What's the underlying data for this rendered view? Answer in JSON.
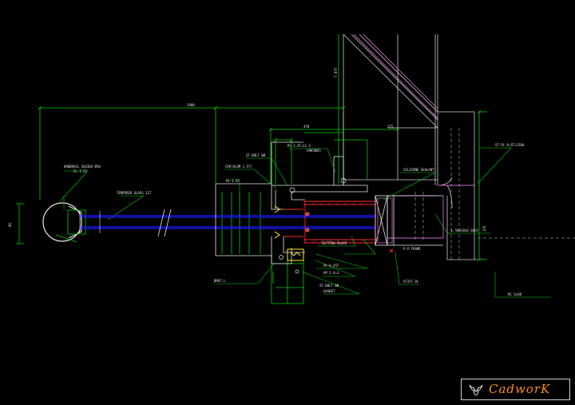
{
  "drawing": {
    "background": "#000000",
    "colors": {
      "outline": "#e0e0e0",
      "dimension": "#00d000",
      "glass": "#1a1aff",
      "section_red": "#ff2a2a",
      "mullion": "#cc66cc",
      "gasket": "#ffee33",
      "note_text": "#e8e8e8"
    },
    "dimensions": {
      "overall": "2400",
      "rail_height": "80",
      "vertical_top": "T 875",
      "depth_a": "470",
      "depth_b": "225",
      "vertical_right": "125"
    },
    "notes": {
      "handrail": "HANDRAIL SUS304 Ø50",
      "handrail_sub": "FL 1.5T",
      "glass": "TEMPERED GLASS 12T",
      "cap_a": "CAP(ALUM 1.5T)",
      "plate": "PL-1.4T",
      "bolt_top": "ST.BOLT 8Ø",
      "channel_top": "ALUM.CHANNEL",
      "anchor_top": "PL 1.4T=11.3",
      "anchor_sub": "(ANCHOR)",
      "sealant": "SILICONE SEALANT",
      "setting": "SETTING BLOCK",
      "plate_bottom": "PL-6.35T",
      "gasket": "GASKET",
      "pipe_frame": "P.P.FRAME",
      "alum_bottom": "ALUM.ANGLE L-40",
      "bolt_bottom": "ST.BOLT 8Ø",
      "anchor_bottom": "AP-1 4=3",
      "stiff": "STIFF.PL",
      "bracket_bottom": "BRKT.L",
      "right_top": "ST.PL 0.6T=1500",
      "right_mid": "L-50x50x6 GALV",
      "right_low": "L-40x40x4 GALV",
      "right_bottom": "RC SLAB"
    }
  },
  "logo": {
    "text": "CadworK",
    "text_color": "#ff8c1a",
    "icon": "bull-head-icon"
  }
}
